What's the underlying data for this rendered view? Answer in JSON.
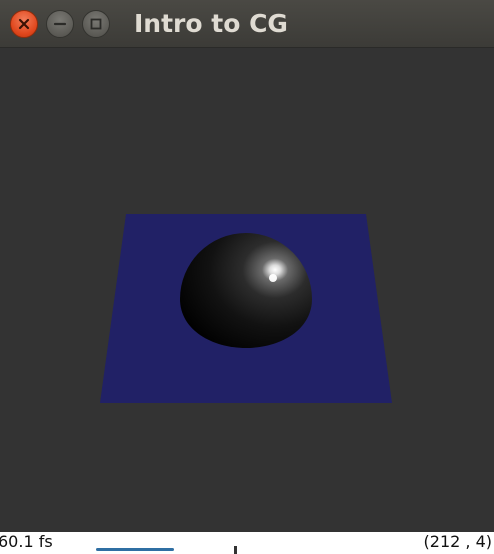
{
  "window": {
    "title": "Intro to CG",
    "controls": {
      "close_icon": "close-icon",
      "minimize_icon": "minimize-icon",
      "maximize_icon": "maximize-icon"
    }
  },
  "scene": {
    "objects": [
      "plane",
      "sphere"
    ],
    "colors": {
      "background": "#333333",
      "plane": "#212166",
      "sphere": "#000000",
      "highlight": "#ffffff"
    }
  },
  "status": {
    "fps_text": "60.1 fs",
    "coords_text": "(212 ,   4)"
  }
}
